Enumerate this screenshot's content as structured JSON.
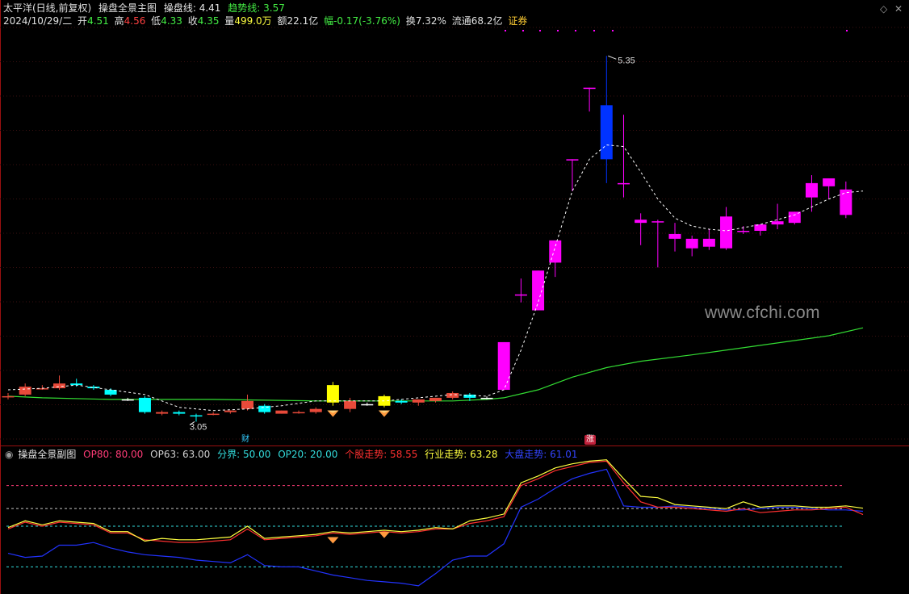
{
  "main_header": {
    "stock_label": "太平洋(日线,前复权)",
    "indicator_name": "操盘全景主图",
    "op_line_label": "操盘线: 4.41",
    "trend_line_label": "趋势线: 3.57"
  },
  "quote": {
    "date": "2024/10/29/二",
    "open_label": "开",
    "open": "4.51",
    "high_label": "高",
    "high": "4.56",
    "low_label": "低",
    "low": "4.33",
    "close_label": "收",
    "close": "4.35",
    "volume_label": "量",
    "volume": "499.0万",
    "amount_label": "额",
    "amount": "22.1亿",
    "change_label": "幅",
    "change": "-0.17(-3.76%)",
    "turnover_label": "换",
    "turnover": "7.32%",
    "float_label": "流通",
    "float_cap": "68.2亿",
    "sector": "证券"
  },
  "sub_header": {
    "indicator_name": "操盘全景副图",
    "op80": "OP80: 80.00",
    "op63": "OP63: 63.00",
    "boundary": "分界: 50.00",
    "op20": "OP20: 20.00",
    "stock_trend": "个股走势: 58.55",
    "industry_trend": "行业走势: 63.28",
    "market_trend": "大盘走势: 61.01"
  },
  "markers": {
    "high_label": "5.35",
    "low_label": "3.05",
    "fin_tag": "财",
    "up_tag": "涨"
  },
  "watermark": "www.cfchi.com",
  "colors": {
    "up": "#ff00ff",
    "down": "#00ffff",
    "small_up": "#e84a3a",
    "white": "#ffffff",
    "yellow": "#ffff00",
    "blue": "#0033ff",
    "ma": "#33dd33",
    "dash": "#ffffff",
    "op80": "#ff3c78",
    "op63": "#c8c8c8",
    "boundary": "#33dddd",
    "op20": "#33dddd",
    "stock": "#ff3030",
    "industry": "#ffff40",
    "market": "#2233ff"
  },
  "chart_data": [
    {
      "type": "candlestick",
      "title": "",
      "ylim": [
        2.9,
        5.6
      ],
      "candles": [
        {
          "o": 3.21,
          "h": 3.23,
          "l": 3.19,
          "c": 3.21,
          "col": "small_up"
        },
        {
          "o": 3.22,
          "h": 3.29,
          "l": 3.21,
          "c": 3.27,
          "col": "small_up"
        },
        {
          "o": 3.26,
          "h": 3.28,
          "l": 3.25,
          "c": 3.26,
          "col": "small_up"
        },
        {
          "o": 3.26,
          "h": 3.34,
          "l": 3.25,
          "c": 3.29,
          "col": "small_up"
        },
        {
          "o": 3.29,
          "h": 3.32,
          "l": 3.27,
          "c": 3.28,
          "col": "down"
        },
        {
          "o": 3.27,
          "h": 3.28,
          "l": 3.25,
          "c": 3.26,
          "col": "down"
        },
        {
          "o": 3.25,
          "h": 3.26,
          "l": 3.21,
          "c": 3.22,
          "col": "down"
        },
        {
          "o": 3.19,
          "h": 3.2,
          "l": 3.18,
          "c": 3.19,
          "col": "white"
        },
        {
          "o": 3.2,
          "h": 3.21,
          "l": 3.1,
          "c": 3.11,
          "col": "down"
        },
        {
          "o": 3.1,
          "h": 3.12,
          "l": 3.09,
          "c": 3.11,
          "col": "small_up"
        },
        {
          "o": 3.11,
          "h": 3.12,
          "l": 3.09,
          "c": 3.1,
          "col": "down"
        },
        {
          "o": 3.09,
          "h": 3.1,
          "l": 3.05,
          "c": 3.09,
          "col": "down"
        },
        {
          "o": 3.1,
          "h": 3.11,
          "l": 3.09,
          "c": 3.1,
          "col": "small_up"
        },
        {
          "o": 3.11,
          "h": 3.12,
          "l": 3.1,
          "c": 3.12,
          "col": "small_up"
        },
        {
          "o": 3.13,
          "h": 3.22,
          "l": 3.12,
          "c": 3.18,
          "col": "small_up"
        },
        {
          "o": 3.15,
          "h": 3.16,
          "l": 3.1,
          "c": 3.11,
          "col": "down"
        },
        {
          "o": 3.1,
          "h": 3.12,
          "l": 3.1,
          "c": 3.12,
          "col": "small_up"
        },
        {
          "o": 3.11,
          "h": 3.12,
          "l": 3.1,
          "c": 3.11,
          "col": "small_up"
        },
        {
          "o": 3.11,
          "h": 3.14,
          "l": 3.1,
          "c": 3.13,
          "col": "small_up"
        },
        {
          "o": 3.17,
          "h": 3.3,
          "l": 3.15,
          "c": 3.28,
          "col": "yellow"
        },
        {
          "o": 3.18,
          "h": 3.2,
          "l": 3.11,
          "c": 3.13,
          "col": "small_up"
        },
        {
          "o": 3.16,
          "h": 3.17,
          "l": 3.15,
          "c": 3.16,
          "col": "white"
        },
        {
          "o": 3.15,
          "h": 3.22,
          "l": 3.14,
          "c": 3.21,
          "col": "yellow"
        },
        {
          "o": 3.17,
          "h": 3.19,
          "l": 3.16,
          "c": 3.18,
          "col": "down"
        },
        {
          "o": 3.17,
          "h": 3.19,
          "l": 3.15,
          "c": 3.19,
          "col": "small_up"
        },
        {
          "o": 3.18,
          "h": 3.2,
          "l": 3.17,
          "c": 3.2,
          "col": "small_up"
        },
        {
          "o": 3.2,
          "h": 3.24,
          "l": 3.19,
          "c": 3.23,
          "col": "small_up"
        },
        {
          "o": 3.22,
          "h": 3.23,
          "l": 3.18,
          "c": 3.2,
          "col": "down"
        },
        {
          "o": 3.2,
          "h": 3.21,
          "l": 3.19,
          "c": 3.2,
          "col": "white"
        },
        {
          "o": 3.25,
          "h": 3.55,
          "l": 3.25,
          "c": 3.55,
          "col": "up"
        },
        {
          "o": 3.85,
          "h": 3.95,
          "l": 3.8,
          "c": 3.85,
          "col": "up"
        },
        {
          "o": 3.75,
          "h": 4.0,
          "l": 3.75,
          "c": 4.0,
          "col": "up"
        },
        {
          "o": 4.05,
          "h": 4.19,
          "l": 3.96,
          "c": 4.19,
          "col": "up"
        },
        {
          "o": 4.7,
          "h": 4.7,
          "l": 4.5,
          "c": 4.7,
          "col": "up"
        },
        {
          "o": 5.15,
          "h": 5.15,
          "l": 5.0,
          "c": 5.15,
          "col": "up"
        },
        {
          "o": 5.04,
          "h": 5.35,
          "l": 4.55,
          "c": 4.7,
          "col": "blue"
        },
        {
          "o": 4.55,
          "h": 4.98,
          "l": 4.46,
          "c": 4.55,
          "col": "up"
        },
        {
          "o": 4.3,
          "h": 4.36,
          "l": 4.16,
          "c": 4.32,
          "col": "up"
        },
        {
          "o": 4.31,
          "h": 4.32,
          "l": 4.02,
          "c": 4.31,
          "col": "up"
        },
        {
          "o": 4.2,
          "h": 4.3,
          "l": 4.12,
          "c": 4.23,
          "col": "up"
        },
        {
          "o": 4.14,
          "h": 4.22,
          "l": 4.09,
          "c": 4.2,
          "col": "up"
        },
        {
          "o": 4.15,
          "h": 4.26,
          "l": 4.13,
          "c": 4.2,
          "col": "up"
        },
        {
          "o": 4.14,
          "h": 4.4,
          "l": 4.13,
          "c": 4.34,
          "col": "up"
        },
        {
          "o": 4.25,
          "h": 4.28,
          "l": 4.23,
          "c": 4.25,
          "col": "up"
        },
        {
          "o": 4.25,
          "h": 4.29,
          "l": 4.22,
          "c": 4.29,
          "col": "up"
        },
        {
          "o": 4.29,
          "h": 4.42,
          "l": 4.26,
          "c": 4.31,
          "col": "up"
        },
        {
          "o": 4.3,
          "h": 4.37,
          "l": 4.29,
          "c": 4.37,
          "col": "up"
        },
        {
          "o": 4.46,
          "h": 4.6,
          "l": 4.37,
          "c": 4.55,
          "col": "up"
        },
        {
          "o": 4.53,
          "h": 4.58,
          "l": 4.45,
          "c": 4.58,
          "col": "up"
        },
        {
          "o": 4.51,
          "h": 4.56,
          "l": 4.33,
          "c": 4.35,
          "col": "up"
        }
      ],
      "ma_series": {
        "name": "趋势线",
        "points": [
          [
            0,
            3.21
          ],
          [
            2,
            3.2
          ],
          [
            6,
            3.19
          ],
          [
            12,
            3.19
          ],
          [
            18,
            3.18
          ],
          [
            22,
            3.18
          ],
          [
            26,
            3.18
          ],
          [
            28,
            3.19
          ],
          [
            29,
            3.2
          ],
          [
            31,
            3.25
          ],
          [
            33,
            3.33
          ],
          [
            35,
            3.39
          ],
          [
            37,
            3.43
          ],
          [
            40,
            3.47
          ],
          [
            44,
            3.53
          ],
          [
            48,
            3.59
          ],
          [
            50,
            3.64
          ]
        ]
      },
      "op_series": {
        "name": "操盘线",
        "points": [
          [
            0,
            3.25
          ],
          [
            2,
            3.26
          ],
          [
            4,
            3.28
          ],
          [
            6,
            3.25
          ],
          [
            8,
            3.22
          ],
          [
            10,
            3.14
          ],
          [
            12,
            3.12
          ],
          [
            14,
            3.13
          ],
          [
            16,
            3.15
          ],
          [
            18,
            3.18
          ],
          [
            20,
            3.18
          ],
          [
            22,
            3.18
          ],
          [
            24,
            3.2
          ],
          [
            26,
            3.22
          ],
          [
            28,
            3.21
          ],
          [
            29,
            3.25
          ],
          [
            30,
            3.5
          ],
          [
            31,
            3.8
          ],
          [
            32,
            4.15
          ],
          [
            33,
            4.5
          ],
          [
            34,
            4.7
          ],
          [
            35,
            4.79
          ],
          [
            36,
            4.78
          ],
          [
            37,
            4.62
          ],
          [
            38,
            4.45
          ],
          [
            39,
            4.33
          ],
          [
            40,
            4.28
          ],
          [
            41,
            4.26
          ],
          [
            42,
            4.25
          ],
          [
            43,
            4.27
          ],
          [
            44,
            4.29
          ],
          [
            45,
            4.32
          ],
          [
            46,
            4.35
          ],
          [
            47,
            4.4
          ],
          [
            48,
            4.45
          ],
          [
            49,
            4.49
          ],
          [
            50,
            4.5
          ]
        ]
      },
      "marker_high_index": 35,
      "marker_low_index": 11
    },
    {
      "type": "line",
      "title": "",
      "ylim": [
        0,
        100
      ],
      "hlines": [
        {
          "name": "OP80",
          "value": 80
        },
        {
          "name": "OP63",
          "value": 63
        },
        {
          "name": "分界",
          "value": 50
        },
        {
          "name": "OP20",
          "value": 20
        }
      ],
      "series": [
        {
          "name": "个股走势",
          "values": [
            48,
            53,
            50,
            53,
            52,
            51,
            45,
            45,
            40,
            39,
            38,
            38,
            39,
            40,
            48,
            40,
            41,
            42,
            43,
            45,
            44,
            45,
            46,
            45,
            46,
            48,
            48,
            52,
            54,
            57,
            80,
            85,
            91,
            94,
            97,
            98,
            82,
            68,
            64,
            64,
            63,
            62,
            61,
            63,
            60,
            61,
            62,
            62,
            63,
            64,
            58.55
          ]
        },
        {
          "name": "行业走势",
          "values": [
            49,
            54,
            51,
            54,
            53,
            52,
            46,
            46,
            39,
            41,
            40,
            40,
            41,
            42,
            50,
            41,
            42,
            43,
            44,
            46,
            45,
            46,
            47,
            46,
            47,
            49,
            48,
            54,
            56,
            59,
            82,
            87,
            93,
            96,
            98,
            99,
            85,
            72,
            71,
            66,
            65,
            64,
            63,
            68,
            64,
            65,
            65,
            64,
            64,
            65,
            63.28
          ]
        },
        {
          "name": "大盘走势",
          "values": [
            30,
            27,
            28,
            36,
            36,
            38,
            34,
            31,
            29,
            28,
            27,
            25,
            24,
            23,
            29,
            21,
            20,
            20,
            17,
            14,
            12,
            10,
            9,
            8,
            6,
            15,
            25,
            28,
            28,
            37,
            64,
            70,
            78,
            85,
            89,
            92,
            65,
            64,
            64,
            65,
            64,
            63,
            62,
            62,
            63,
            64,
            64,
            63,
            62,
            62,
            61.01
          ]
        }
      ]
    }
  ]
}
